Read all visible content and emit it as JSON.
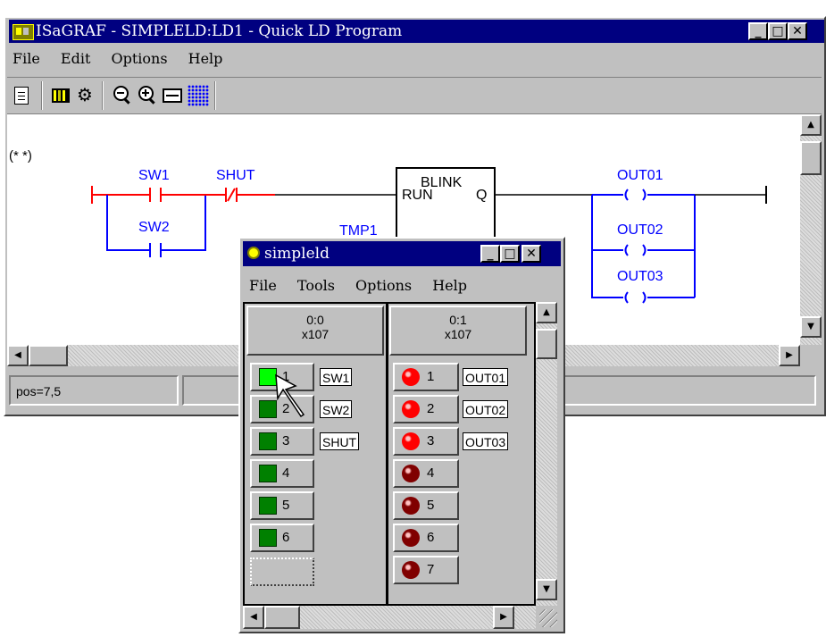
{
  "main_window": {
    "title": "ISaGRAF - SIMPLELD:LD1 - Quick LD Program",
    "menu": [
      "File",
      "Edit",
      "Options",
      "Help"
    ],
    "toolbar_icons": [
      "new-document-icon",
      "library-icon",
      "settings-icon",
      "zoom-out-icon",
      "zoom-in-icon",
      "fit-width-icon",
      "grid-icon"
    ],
    "comment": "(* *)",
    "contacts": {
      "sw1": "SW1",
      "sw2": "SW2",
      "shut": "SHUT"
    },
    "function_block": {
      "name": "BLINK",
      "input": "RUN",
      "output": "Q",
      "instance": "TMP1"
    },
    "coils": {
      "out01": "OUT01",
      "out02": "OUT02",
      "out03": "OUT03"
    },
    "status": "pos=7,5"
  },
  "sim_window": {
    "title": "simpleld",
    "menu": [
      "File",
      "Tools",
      "Options",
      "Help"
    ],
    "boards": [
      {
        "slot": "0:0",
        "type": "x107"
      },
      {
        "slot": "0:1",
        "type": "x107"
      }
    ],
    "inputs": [
      {
        "num": "1",
        "label": "SW1",
        "on": true
      },
      {
        "num": "2",
        "label": "SW2",
        "on": false
      },
      {
        "num": "3",
        "label": "SHUT",
        "on": false
      },
      {
        "num": "4",
        "label": "",
        "on": false
      },
      {
        "num": "5",
        "label": "",
        "on": false
      },
      {
        "num": "6",
        "label": "",
        "on": false
      }
    ],
    "outputs": [
      {
        "num": "1",
        "label": "OUT01",
        "on": true
      },
      {
        "num": "2",
        "label": "OUT02",
        "on": true
      },
      {
        "num": "3",
        "label": "OUT03",
        "on": true
      },
      {
        "num": "4",
        "label": "",
        "on": false
      },
      {
        "num": "5",
        "label": "",
        "on": false
      },
      {
        "num": "6",
        "label": "",
        "on": false
      },
      {
        "num": "7",
        "label": "",
        "on": false
      }
    ]
  },
  "colors": {
    "rail_red": "#ff0000",
    "wire_blue": "#0000ff",
    "input_on": "#00ff00",
    "input_off": "#008000",
    "led_on": "#ff0000",
    "led_off": "#800000"
  }
}
